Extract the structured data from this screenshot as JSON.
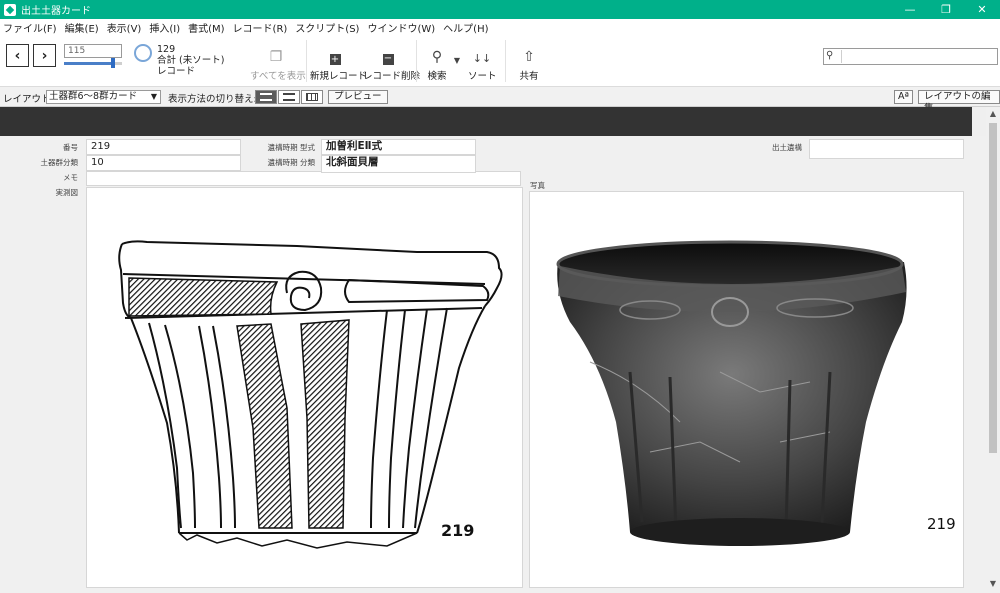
{
  "window": {
    "title": "出土土器カード"
  },
  "menu": [
    "ファイル(F)",
    "編集(E)",
    "表示(V)",
    "挿入(I)",
    "書式(M)",
    "レコード(R)",
    "スクリプト(S)",
    "ウインドウ(W)",
    "ヘルプ(H)"
  ],
  "toolbar": {
    "record_input": "115",
    "record_total": "129",
    "record_summary": "合計 (未ソート)",
    "record_label": "レコード",
    "show_all": "すべてを表示",
    "new_record": "新規レコード",
    "delete_record": "レコード削除",
    "search": "検索",
    "sort": "ソート",
    "share": "共有",
    "slider_fraction": 0.85
  },
  "layoutbar": {
    "layout_label": "レイアウト:",
    "layout_value": "土器群6～8群カード",
    "view_label": "表示方法の切り替え:",
    "preview": "プレビュー",
    "aa": "Aª",
    "edit_layout": "レイアウトの編集"
  },
  "form": {
    "labels": {
      "number": "番号",
      "group": "土器群分類",
      "memo": "メモ",
      "drawing": "実測図",
      "period_type": "遺構時期 型式",
      "period_class": "遺構時期 分類",
      "site": "出土遺構",
      "photo": "写真"
    },
    "values": {
      "number": "219",
      "group": "10",
      "period_type": "加曽利EⅡ式",
      "period_class": "北斜面貝層",
      "site": "",
      "memo": ""
    },
    "drawing_caption": "219",
    "photo_caption": "219"
  }
}
